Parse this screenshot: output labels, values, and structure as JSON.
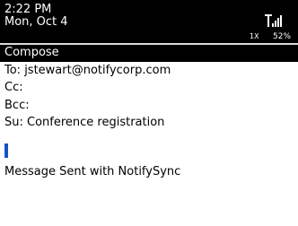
{
  "status_bar": {
    "time": "2:22 PM",
    "date": "Mon, Oct 4",
    "network": "1X",
    "battery": "52%",
    "signal_icon": "signal-strength-icon"
  },
  "title_bar": {
    "title": "Compose"
  },
  "compose": {
    "to": "To: jstewart@notifycorp.com",
    "cc": "Cc:",
    "bcc": "Bcc:",
    "subject": "Su: Conference registration",
    "signature": "Message Sent with NotifySync"
  },
  "colors": {
    "bar_background": "#000000",
    "title_separator": "#dcdcdc",
    "cursor": "#1452c8"
  }
}
